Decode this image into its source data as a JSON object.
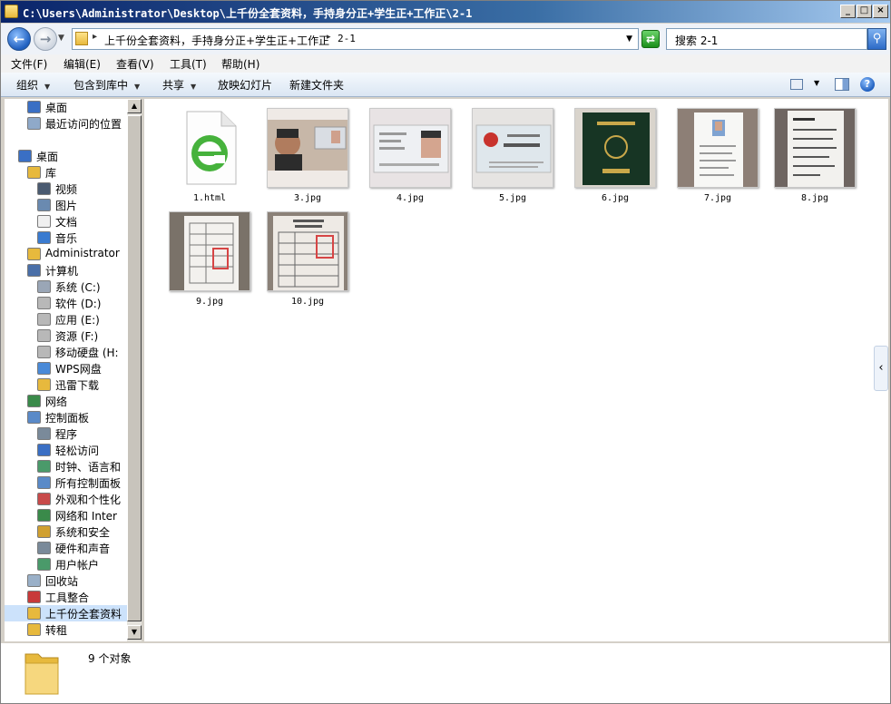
{
  "window": {
    "title": "C:\\Users\\Administrator\\Desktop\\上千份全套资料，手持身分正+学生正+工作正\\2-1",
    "minimize": "_",
    "maximize": "□",
    "close": "×"
  },
  "address": {
    "crumb1": "上千份全套资料，手持身分正+学生正+工作正",
    "crumb2": "2-1",
    "search_placeholder": "搜索 2-1"
  },
  "menu": [
    "文件(F)",
    "编辑(E)",
    "查看(V)",
    "工具(T)",
    "帮助(H)"
  ],
  "commands": {
    "organize": "组织",
    "include_library": "包含到库中",
    "share": "共享",
    "slideshow": "放映幻灯片",
    "new_folder": "新建文件夹"
  },
  "nav": [
    {
      "label": "桌面",
      "icon": "desktop-icon",
      "color": "#3a6fc4"
    },
    {
      "label": "最近访问的位置",
      "icon": "recent-places-icon",
      "color": "#8fa9c9"
    },
    {
      "label": "桌面",
      "icon": "desktop-icon",
      "color": "#3a6fc4"
    },
    {
      "label": "库",
      "icon": "library-icon",
      "color": "#e7b93d"
    },
    {
      "label": "视频",
      "icon": "video-icon",
      "color": "#4a5a70"
    },
    {
      "label": "图片",
      "icon": "pictures-icon",
      "color": "#6a8ab0"
    },
    {
      "label": "文档",
      "icon": "documents-icon",
      "color": "#f0f0f0"
    },
    {
      "label": "音乐",
      "icon": "music-icon",
      "color": "#3a7bd0"
    },
    {
      "label": "Administrator",
      "icon": "user-folder-icon",
      "color": "#e7b93d"
    },
    {
      "label": "计算机",
      "icon": "computer-icon",
      "color": "#4a6fa8"
    },
    {
      "label": "系统 (C:)",
      "icon": "drive-c-icon",
      "color": "#9aa6b6"
    },
    {
      "label": "软件 (D:)",
      "icon": "drive-d-icon",
      "color": "#b8b8b8"
    },
    {
      "label": "应用 (E:)",
      "icon": "drive-e-icon",
      "color": "#b8b8b8"
    },
    {
      "label": "资源 (F:)",
      "icon": "drive-f-icon",
      "color": "#b8b8b8"
    },
    {
      "label": "移动硬盘 (H:",
      "icon": "removable-drive-icon",
      "color": "#b8b8b8"
    },
    {
      "label": "WPS网盘",
      "icon": "cloud-icon",
      "color": "#4a8ad8"
    },
    {
      "label": "迅雷下载",
      "icon": "download-folder-icon",
      "color": "#e7b93d"
    },
    {
      "label": "网络",
      "icon": "network-icon",
      "color": "#3a8a4a"
    },
    {
      "label": "控制面板",
      "icon": "control-panel-icon",
      "color": "#5a8ac8"
    },
    {
      "label": "程序",
      "icon": "programs-icon",
      "color": "#7a8a9a"
    },
    {
      "label": "轻松访问",
      "icon": "ease-of-access-icon",
      "color": "#3a6fc4"
    },
    {
      "label": "时钟、语言和",
      "icon": "clock-language-icon",
      "color": "#4a9a6a"
    },
    {
      "label": "所有控制面板",
      "icon": "all-control-panel-icon",
      "color": "#5a8ac8"
    },
    {
      "label": "外观和个性化",
      "icon": "appearance-icon",
      "color": "#c84a4a"
    },
    {
      "label": "网络和 Inter",
      "icon": "network-internet-icon",
      "color": "#3a8a4a"
    },
    {
      "label": "系统和安全",
      "icon": "system-security-icon",
      "color": "#d0a030"
    },
    {
      "label": "硬件和声音",
      "icon": "hardware-sound-icon",
      "color": "#7a8a9a"
    },
    {
      "label": "用户帐户",
      "icon": "user-accounts-icon",
      "color": "#4a9a6a"
    },
    {
      "label": "回收站",
      "icon": "recycle-bin-icon",
      "color": "#9ab0c8"
    },
    {
      "label": "工具整合",
      "icon": "tools-icon",
      "color": "#c83a3a"
    },
    {
      "label": "上千份全套资料",
      "icon": "folder-icon",
      "color": "#e7b93d"
    },
    {
      "label": "转租",
      "icon": "folder-icon",
      "color": "#e7b93d"
    }
  ],
  "files": [
    {
      "name": "1.html",
      "kind": "html"
    },
    {
      "name": "3.jpg",
      "kind": "photo-person"
    },
    {
      "name": "4.jpg",
      "kind": "id-front"
    },
    {
      "name": "5.jpg",
      "kind": "id-back"
    },
    {
      "name": "6.jpg",
      "kind": "student-card"
    },
    {
      "name": "7.jpg",
      "kind": "form-photo"
    },
    {
      "name": "8.jpg",
      "kind": "handwritten-form"
    },
    {
      "name": "9.jpg",
      "kind": "stamped-form"
    },
    {
      "name": "10.jpg",
      "kind": "stamped-form-2"
    }
  ],
  "status": {
    "count": "9 个对象"
  }
}
